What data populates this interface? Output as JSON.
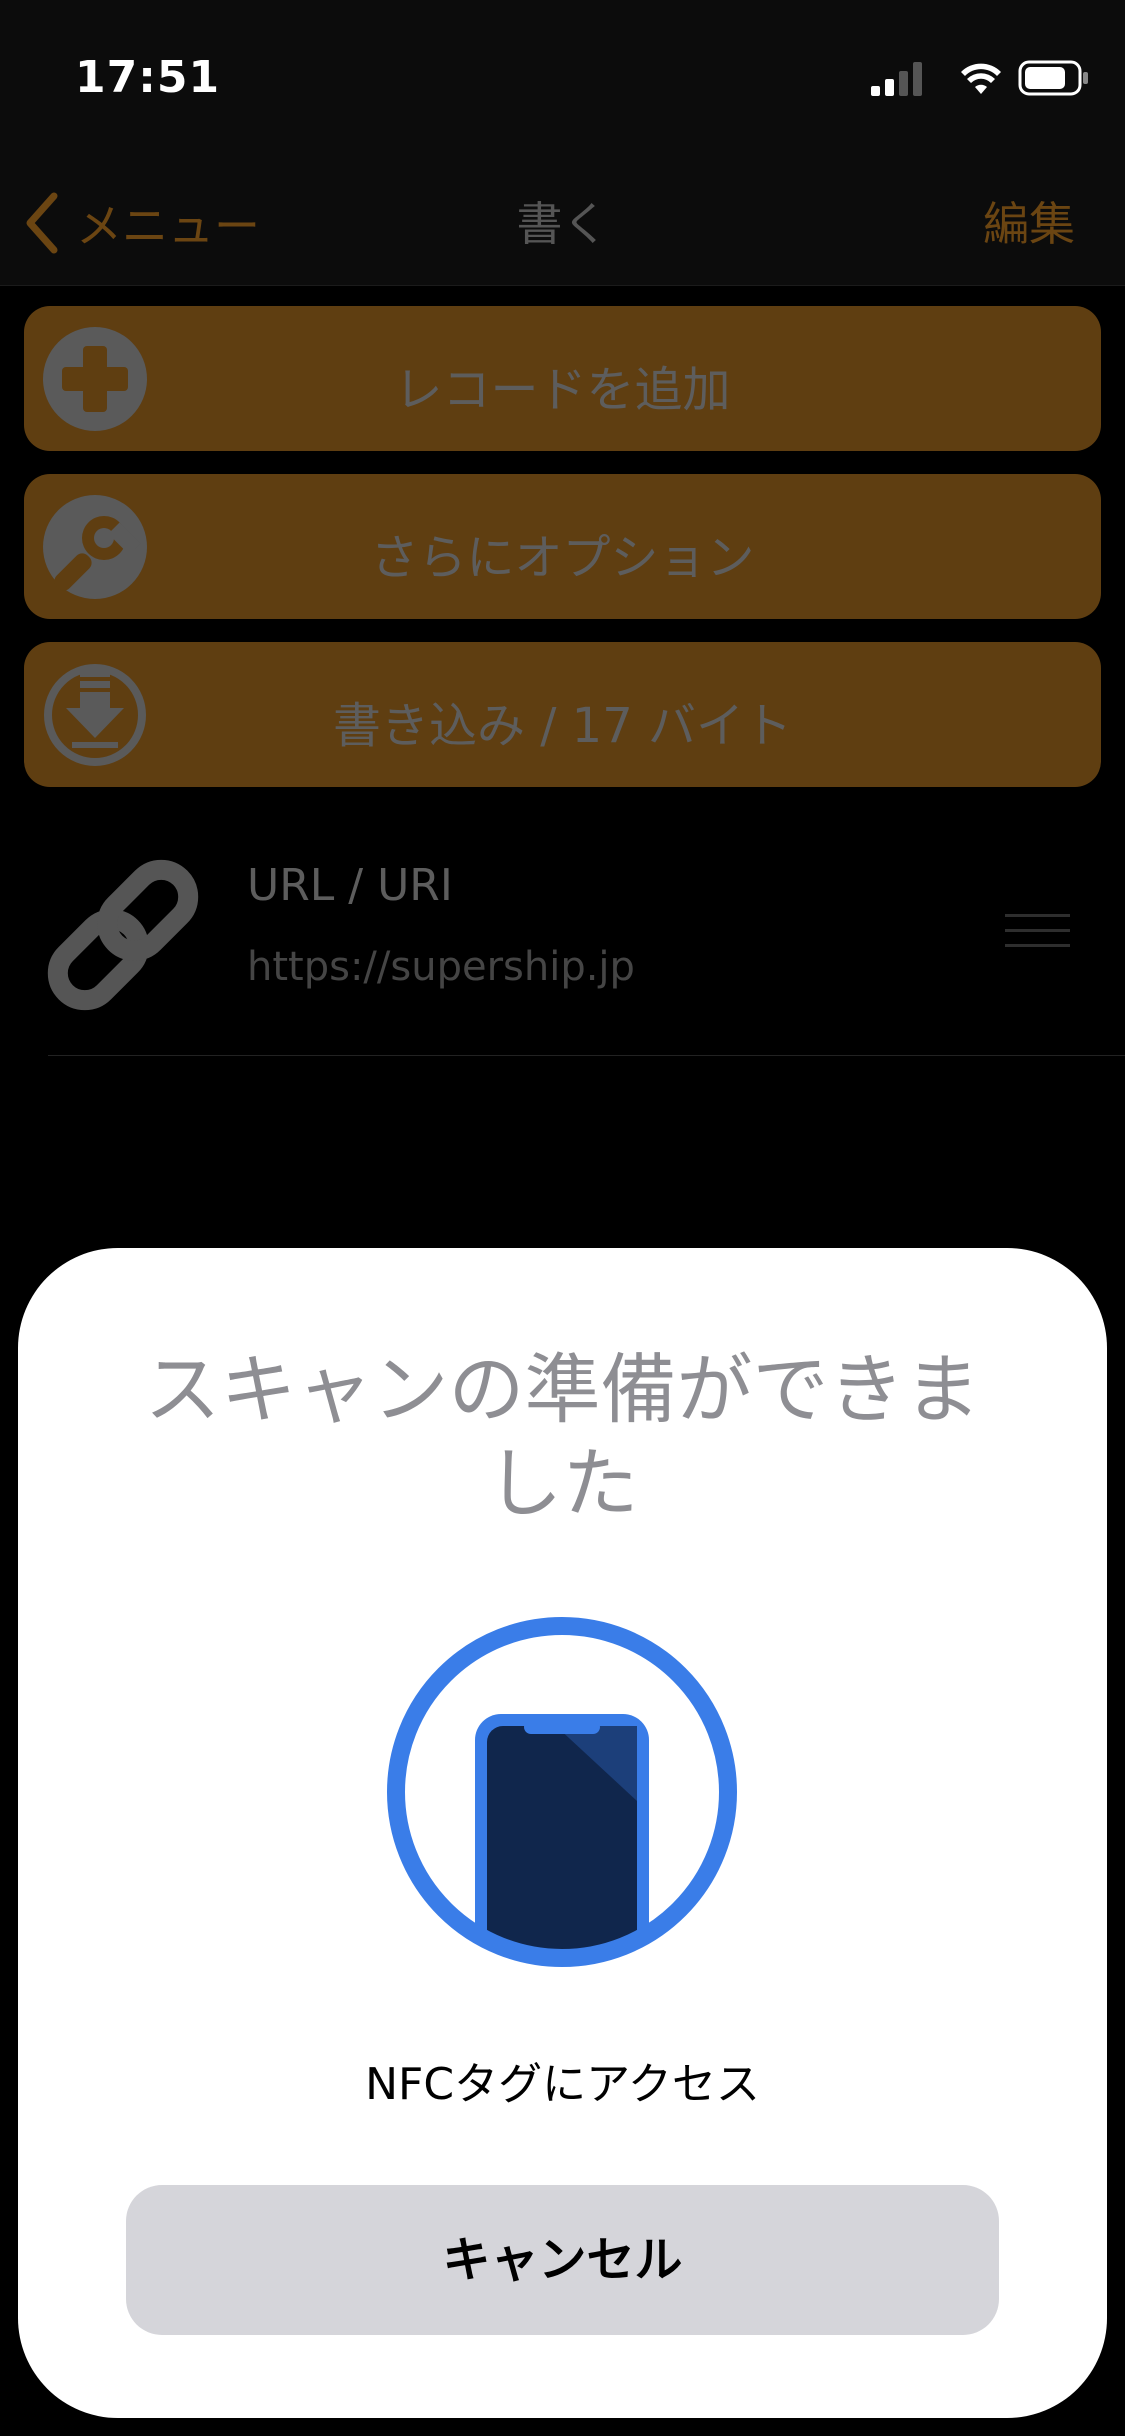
{
  "status_bar": {
    "time": "17:51"
  },
  "nav": {
    "back_label": "メニュー",
    "title": "書く",
    "edit_label": "編集"
  },
  "actions": [
    {
      "label": "レコードを追加",
      "icon": "plus-circle-icon"
    },
    {
      "label": "さらにオプション",
      "icon": "wrench-icon"
    },
    {
      "label": "書き込み / 17 バイト",
      "icon": "download-icon"
    }
  ],
  "record": {
    "title": "URL / URI",
    "value": "https://supership.jp",
    "icon": "link-icon"
  },
  "sheet": {
    "title": "スキャンの準備ができました",
    "message": "NFCタグにアクセス",
    "cancel_label": "キャンセル",
    "graphic": "nfc-phone-icon"
  },
  "colors": {
    "accent": "#6b4512",
    "button_bg": "#5f3e11",
    "nfc_blue": "#3a7de8",
    "phone_dark": "#10264c"
  }
}
